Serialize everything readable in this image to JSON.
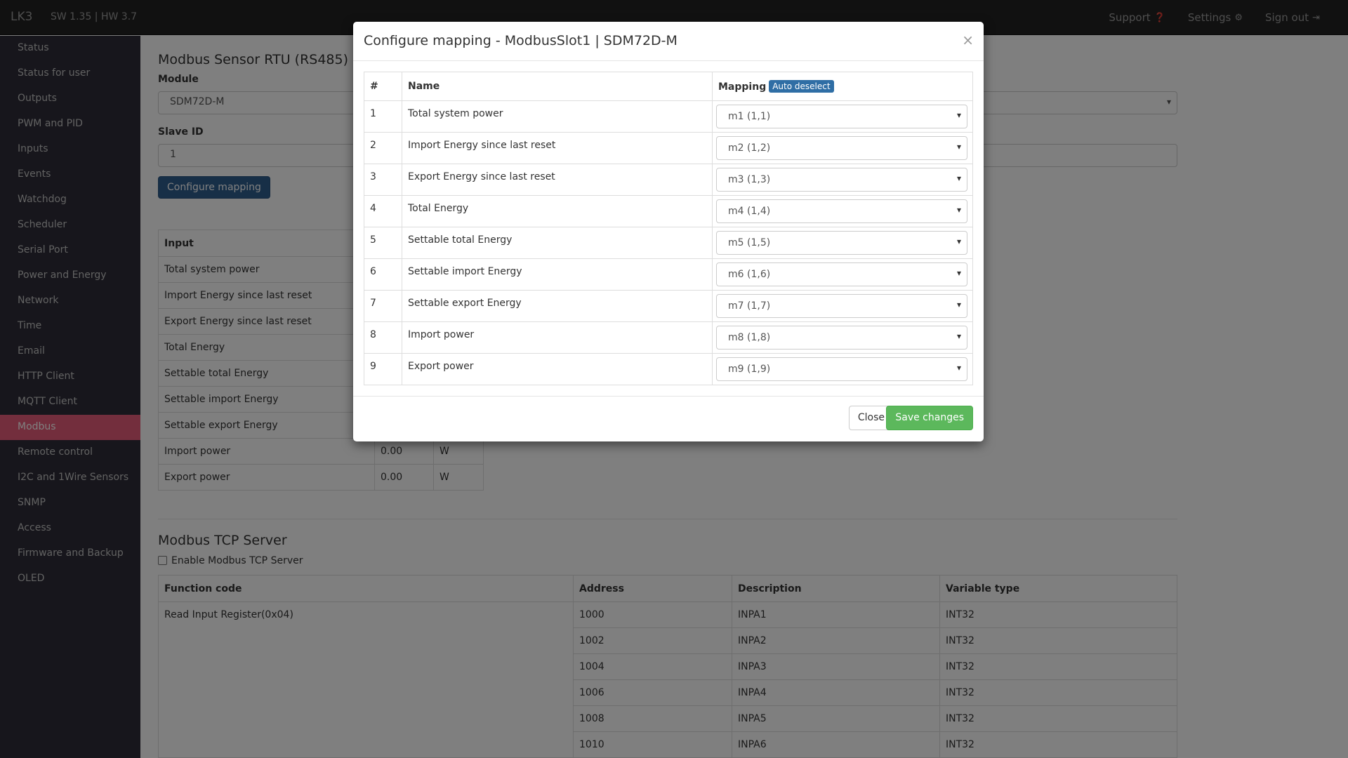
{
  "navbar": {
    "brand": "LK3",
    "version": "SW 1.35 | HW 3.7",
    "support": "Support",
    "settings": "Settings",
    "signout": "Sign out"
  },
  "sidebar": {
    "items": [
      {
        "label": "Status"
      },
      {
        "label": "Status for user"
      },
      {
        "label": "Outputs"
      },
      {
        "label": "PWM and PID"
      },
      {
        "label": "Inputs"
      },
      {
        "label": "Events"
      },
      {
        "label": "Watchdog"
      },
      {
        "label": "Scheduler"
      },
      {
        "label": "Serial Port"
      },
      {
        "label": "Power and Energy"
      },
      {
        "label": "Network"
      },
      {
        "label": "Time"
      },
      {
        "label": "Email"
      },
      {
        "label": "HTTP Client"
      },
      {
        "label": "MQTT Client"
      },
      {
        "label": "Modbus"
      },
      {
        "label": "Remote control"
      },
      {
        "label": "I2C and 1Wire Sensors"
      },
      {
        "label": "SNMP"
      },
      {
        "label": "Access"
      },
      {
        "label": "Firmware and Backup"
      },
      {
        "label": "OLED"
      }
    ],
    "active": "Modbus"
  },
  "rtu": {
    "title": "Modbus Sensor RTU (RS485)",
    "module_label": "Module",
    "module_value": "SDM72D-M",
    "slave_label": "Slave ID",
    "slave_value": "1",
    "configure_button": "Configure mapping",
    "table_header_input": "Input",
    "rows": [
      {
        "name": "Total system power",
        "value": "",
        "unit": ""
      },
      {
        "name": "Import Energy since last reset",
        "value": "",
        "unit": ""
      },
      {
        "name": "Export Energy since last reset",
        "value": "",
        "unit": ""
      },
      {
        "name": "Total Energy",
        "value": "",
        "unit": ""
      },
      {
        "name": "Settable total Energy",
        "value": "",
        "unit": ""
      },
      {
        "name": "Settable import Energy",
        "value": "",
        "unit": ""
      },
      {
        "name": "Settable export Energy",
        "value": "",
        "unit": ""
      },
      {
        "name": "Import power",
        "value": "0.00",
        "unit": "W"
      },
      {
        "name": "Export power",
        "value": "0.00",
        "unit": "W"
      }
    ]
  },
  "tcp": {
    "title": "Modbus TCP Server",
    "enable_label": "Enable Modbus TCP Server",
    "headers": [
      "Function code",
      "Address",
      "Description",
      "Variable type"
    ],
    "function_code": "Read Input Register(0x04)",
    "rows": [
      {
        "address": "1000",
        "description": "INPA1",
        "type": "INT32"
      },
      {
        "address": "1002",
        "description": "INPA2",
        "type": "INT32"
      },
      {
        "address": "1004",
        "description": "INPA3",
        "type": "INT32"
      },
      {
        "address": "1006",
        "description": "INPA4",
        "type": "INT32"
      },
      {
        "address": "1008",
        "description": "INPA5",
        "type": "INT32"
      },
      {
        "address": "1010",
        "description": "INPA6",
        "type": "INT32"
      }
    ]
  },
  "modal": {
    "title": "Configure mapping - ModbusSlot1 | SDM72D-M",
    "close_x": "×",
    "headers": {
      "num": "#",
      "name": "Name",
      "mapping": "Mapping"
    },
    "auto_deselect": "Auto deselect",
    "rows": [
      {
        "num": "1",
        "name": "Total system power",
        "mapping": "m1 (1,1)"
      },
      {
        "num": "2",
        "name": "Import Energy since last reset",
        "mapping": "m2 (1,2)"
      },
      {
        "num": "3",
        "name": "Export Energy since last reset",
        "mapping": "m3 (1,3)"
      },
      {
        "num": "4",
        "name": "Total Energy",
        "mapping": "m4 (1,4)"
      },
      {
        "num": "5",
        "name": "Settable total Energy",
        "mapping": "m5 (1,5)"
      },
      {
        "num": "6",
        "name": "Settable import Energy",
        "mapping": "m6 (1,6)"
      },
      {
        "num": "7",
        "name": "Settable export Energy",
        "mapping": "m7 (1,7)"
      },
      {
        "num": "8",
        "name": "Import power",
        "mapping": "m8 (1,8)"
      },
      {
        "num": "9",
        "name": "Export power",
        "mapping": "m9 (1,9)"
      }
    ],
    "close_button": "Close",
    "save_button": "Save changes"
  }
}
